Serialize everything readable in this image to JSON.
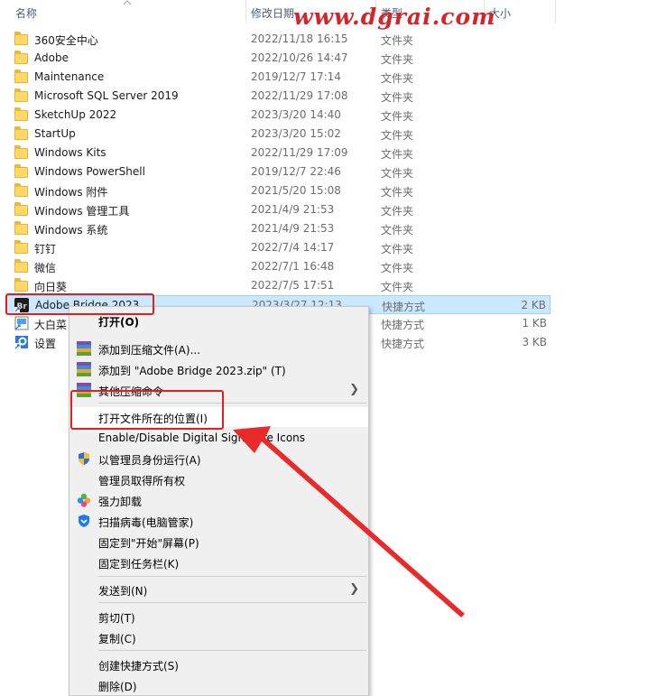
{
  "header": {
    "name": "名称",
    "modified": "修改日期",
    "type": "类型",
    "size": "大小"
  },
  "watermark": "www.dgrai.com",
  "files": [
    {
      "name": "360安全中心",
      "date": "2022/11/18 16:15",
      "type": "文件夹",
      "size": "",
      "icon": "folder-icon"
    },
    {
      "name": "Adobe",
      "date": "2022/10/26 14:47",
      "type": "文件夹",
      "size": "",
      "icon": "folder-icon"
    },
    {
      "name": "Maintenance",
      "date": "2019/12/7 17:14",
      "type": "文件夹",
      "size": "",
      "icon": "folder-icon"
    },
    {
      "name": "Microsoft SQL Server 2019",
      "date": "2022/11/29 17:08",
      "type": "文件夹",
      "size": "",
      "icon": "folder-icon"
    },
    {
      "name": "SketchUp 2022",
      "date": "2023/3/20 14:40",
      "type": "文件夹",
      "size": "",
      "icon": "folder-icon"
    },
    {
      "name": "StartUp",
      "date": "2023/3/20 15:02",
      "type": "文件夹",
      "size": "",
      "icon": "folder-icon"
    },
    {
      "name": "Windows Kits",
      "date": "2022/11/29 17:09",
      "type": "文件夹",
      "size": "",
      "icon": "folder-icon"
    },
    {
      "name": "Windows PowerShell",
      "date": "2019/12/7 22:46",
      "type": "文件夹",
      "size": "",
      "icon": "folder-icon"
    },
    {
      "name": "Windows 附件",
      "date": "2021/5/20 15:08",
      "type": "文件夹",
      "size": "",
      "icon": "folder-icon"
    },
    {
      "name": "Windows 管理工具",
      "date": "2021/4/9 21:53",
      "type": "文件夹",
      "size": "",
      "icon": "folder-icon"
    },
    {
      "name": "Windows 系统",
      "date": "2021/4/9 21:53",
      "type": "文件夹",
      "size": "",
      "icon": "folder-icon"
    },
    {
      "name": "钉钉",
      "date": "2022/7/4 14:17",
      "type": "文件夹",
      "size": "",
      "icon": "folder-icon"
    },
    {
      "name": "微信",
      "date": "2022/7/1 16:48",
      "type": "文件夹",
      "size": "",
      "icon": "folder-icon"
    },
    {
      "name": "向日葵",
      "date": "2022/7/5 17:51",
      "type": "文件夹",
      "size": "",
      "icon": "folder-icon"
    },
    {
      "name": "Adobe Bridge 2023",
      "date": "2023/3/27 12:13",
      "type": "快捷方式",
      "size": "2 KB",
      "icon": "adobe-bridge-icon"
    },
    {
      "name": "大白菜",
      "date": "",
      "type": "快捷方式",
      "size": "1 KB",
      "icon": "shortcut-app-icon"
    },
    {
      "name": "设置",
      "date": "",
      "type": "快捷方式",
      "size": "3 KB",
      "icon": "settings-shortcut-icon"
    }
  ],
  "context_menu": {
    "open": "打开(O)",
    "add_archive": "添加到压缩文件(A)...",
    "add_zip": "添加到 \"Adobe Bridge 2023.zip\" (T)",
    "other_compress": "其他压缩命令",
    "open_location": "打开文件所在的位置(I)",
    "digital_sig": "Enable/Disable Digital Signature Icons",
    "run_as_admin": "以管理员身份运行(A)",
    "take_ownership": "管理员取得所有权",
    "force_uninstall": "强力卸载",
    "scan_virus": "扫描病毒(电脑管家)",
    "pin_start": "固定到\"开始\"屏幕(P)",
    "pin_taskbar": "固定到任务栏(K)",
    "send_to": "发送到(N)",
    "cut": "剪切(T)",
    "copy": "复制(C)",
    "create_shortcut": "创建快捷方式(S)",
    "delete": "删除(D)"
  }
}
